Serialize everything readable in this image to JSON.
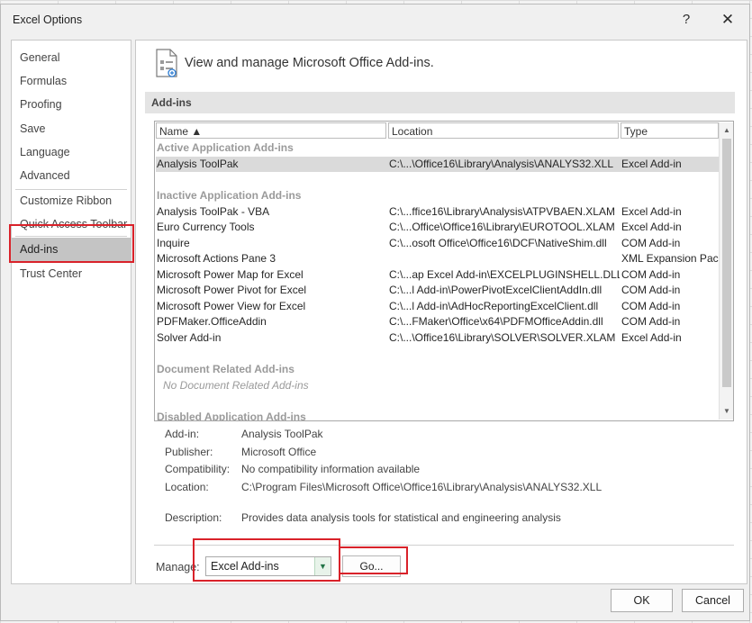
{
  "window": {
    "title": "Excel Options",
    "help_glyph": "?",
    "close_glyph": "✕"
  },
  "nav": {
    "items": [
      "General",
      "Formulas",
      "Proofing",
      "Save",
      "Language",
      "Advanced",
      "Customize Ribbon",
      "Quick Access Toolbar",
      "Add-ins",
      "Trust Center"
    ],
    "selected": "Add-ins"
  },
  "header": {
    "text": "View and manage Microsoft Office Add-ins.",
    "icon": "add-ins-page-icon"
  },
  "section": {
    "title": "Add-ins"
  },
  "list": {
    "columns": [
      "Name ▲",
      "Location",
      "Type"
    ],
    "groups": {
      "active": "Active Application Add-ins",
      "inactive": "Inactive Application Add-ins",
      "document": "Document Related Add-ins",
      "document_none": "No Document Related Add-ins",
      "disabled": "Disabled Application Add-ins"
    },
    "active_rows": [
      {
        "name": "Analysis ToolPak",
        "location": "C:\\...\\Office16\\Library\\Analysis\\ANALYS32.XLL",
        "type": "Excel Add-in"
      }
    ],
    "inactive_rows": [
      {
        "name": "Analysis ToolPak - VBA",
        "location": "C:\\...ffice16\\Library\\Analysis\\ATPVBAEN.XLAM",
        "type": "Excel Add-in"
      },
      {
        "name": "Euro Currency Tools",
        "location": "C:\\...Office\\Office16\\Library\\EUROTOOL.XLAM",
        "type": "Excel Add-in"
      },
      {
        "name": "Inquire",
        "location": "C:\\...osoft Office\\Office16\\DCF\\NativeShim.dll",
        "type": "COM Add-in"
      },
      {
        "name": "Microsoft Actions Pane 3",
        "location": "",
        "type": "XML Expansion Pack"
      },
      {
        "name": "Microsoft Power Map for Excel",
        "location": "C:\\...ap Excel Add-in\\EXCELPLUGINSHELL.DLL",
        "type": "COM Add-in"
      },
      {
        "name": "Microsoft Power Pivot for Excel",
        "location": "C:\\...l Add-in\\PowerPivotExcelClientAddIn.dll",
        "type": "COM Add-in"
      },
      {
        "name": "Microsoft Power View for Excel",
        "location": "C:\\...l Add-in\\AdHocReportingExcelClient.dll",
        "type": "COM Add-in"
      },
      {
        "name": "PDFMaker.OfficeAddin",
        "location": "C:\\...FMaker\\Office\\x64\\PDFMOfficeAddin.dll",
        "type": "COM Add-in"
      },
      {
        "name": "Solver Add-in",
        "location": "C:\\...\\Office16\\Library\\SOLVER\\SOLVER.XLAM",
        "type": "Excel Add-in"
      }
    ]
  },
  "details": {
    "addin_label": "Add-in:",
    "addin_value": "Analysis ToolPak",
    "publisher_label": "Publisher:",
    "publisher_value": "Microsoft Office",
    "compat_label": "Compatibility:",
    "compat_value": "No compatibility information available",
    "location_label": "Location:",
    "location_value": "C:\\Program Files\\Microsoft Office\\Office16\\Library\\Analysis\\ANALYS32.XLL",
    "description_label": "Description:",
    "description_value": "Provides data analysis tools for statistical and engineering analysis"
  },
  "manage": {
    "label": "Manage:",
    "selected": "Excel Add-ins",
    "go_label": "Go..."
  },
  "buttons": {
    "ok": "OK",
    "cancel": "Cancel"
  },
  "colors": {
    "highlight_box": "#d9222a",
    "selected_nav": "#c4c4c4",
    "combo_accent": "#217346"
  }
}
